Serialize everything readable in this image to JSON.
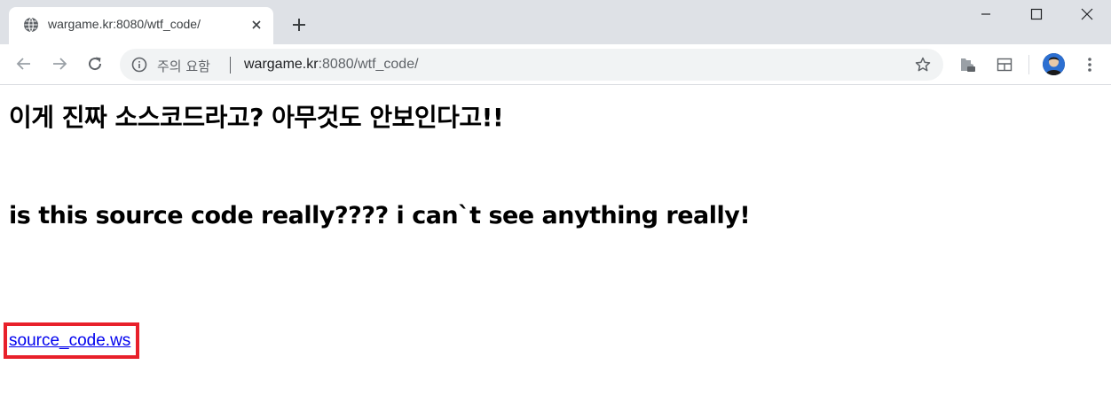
{
  "browser": {
    "tab": {
      "title": "wargame.kr:8080/wtf_code/",
      "favicon": "globe-icon",
      "close_icon": "close-icon"
    },
    "new_tab_icon": "plus-icon",
    "window_controls": [
      "minimize-icon",
      "maximize-icon",
      "close-icon"
    ],
    "toolbar": {
      "back_icon": "back-arrow-icon",
      "forward_icon": "forward-arrow-icon",
      "reload_icon": "reload-icon",
      "security_label": "주의 요함",
      "url_host": "wargame.kr",
      "url_rest": ":8080/wtf_code/",
      "bookmark_icon": "star-icon",
      "extensions": [
        "extension-icon",
        "cast-tab-icon"
      ],
      "menu_icon": "kebab-menu-icon"
    }
  },
  "page": {
    "heading_ko": "이게 진짜 소스코드라고? 아무것도 안보인다고!!",
    "heading_en": "is this source code really???? i can`t see anything really!",
    "link_text": "source_code.ws",
    "highlight_color": "#e8202a",
    "link_color": "#0000ee"
  }
}
